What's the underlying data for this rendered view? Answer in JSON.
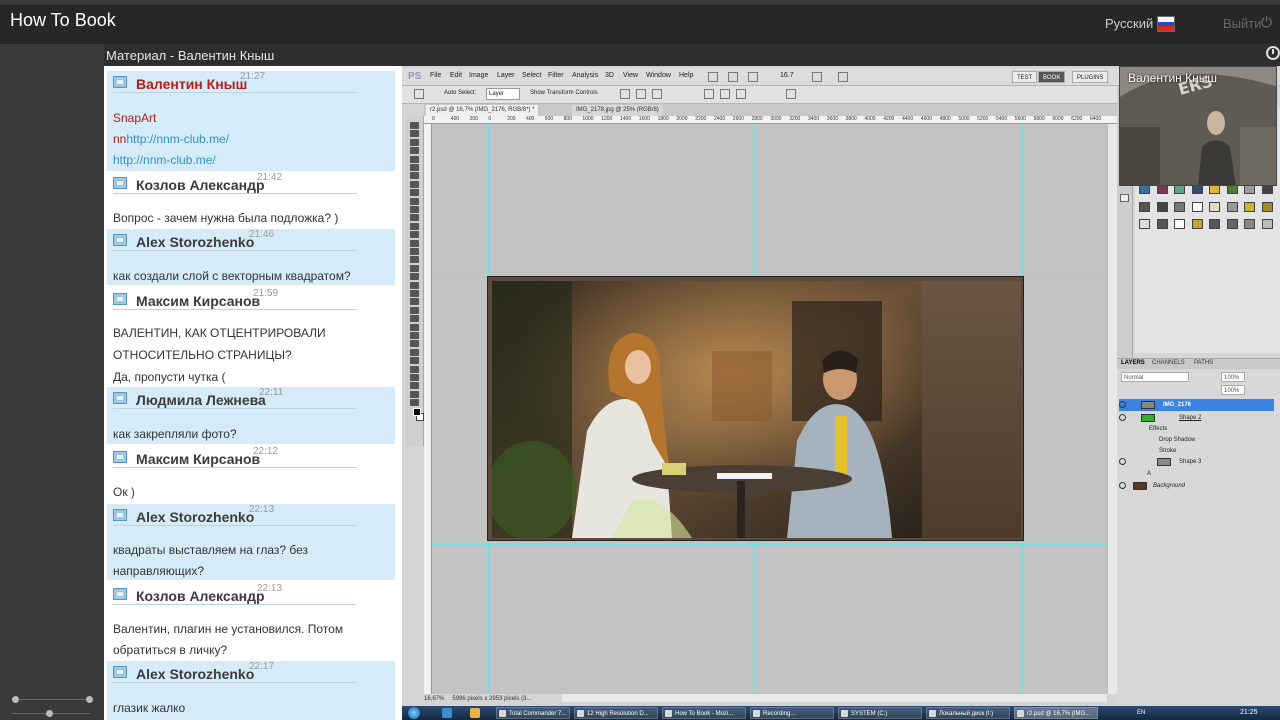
{
  "header": {
    "brand": "How To Book",
    "language": "Русский",
    "logout": "Выйти"
  },
  "material": {
    "title": "Материал - Валентин Кныш"
  },
  "chat": {
    "messages": [
      {
        "name": "Валентин Кныш",
        "time": "21:27",
        "lines": [
          "SnapArt"
        ],
        "link_prefix": "nn",
        "links": [
          "http://nnm-club.me/",
          "http://nnm-club.me/"
        ]
      },
      {
        "name": "Козлов Александр",
        "time": "21:42",
        "lines": [
          "Вопрос - зачем нужна была подложка? )"
        ]
      },
      {
        "name": "Alex Storozhenko",
        "time": "21:46",
        "lines": [
          "как создали слой с векторным квадратом?"
        ]
      },
      {
        "name": "Максим Кирсанов",
        "time": "21:59",
        "lines": [
          "ВАЛЕНТИН, КАК ОТЦЕНТРИРОВАЛИ",
          "ОТНОСИТЕЛЬНО СТРАНИЦЫ?",
          "Да, пропусти чутка ("
        ]
      },
      {
        "name": "Людмила Лежнева",
        "time": "22:11",
        "lines": [
          "как закрепляли фото?"
        ]
      },
      {
        "name": "Максим Кирсанов",
        "time": "22:12",
        "lines": [
          "Ок )"
        ]
      },
      {
        "name": "Alex Storozhenko",
        "time": "22:13",
        "lines": [
          "квадраты выставляем на глаз? без",
          "направляющих?"
        ]
      },
      {
        "name": "Козлов Александр",
        "time": "22:13",
        "lines": [
          "Валентин, плагин не установился. Потом",
          "обратиться в личку?"
        ]
      },
      {
        "name": "Alex Storozhenko",
        "time": "22:17",
        "lines": [
          "глазик жалко"
        ]
      }
    ]
  },
  "photoshop": {
    "logo": "PS",
    "menu": [
      "File",
      "Edit",
      "Image",
      "Layer",
      "Select",
      "Filter",
      "Analysis",
      "3D",
      "View",
      "Window",
      "Help"
    ],
    "zoom_field": "16.7",
    "workspaces": [
      "TEST",
      "BOOK",
      "PLUGINS"
    ],
    "options": {
      "auto_select": "Auto Select:",
      "auto_select_value": "Layer",
      "transform": "Show Transform Controls"
    },
    "tabs": [
      "r2.psd @ 16,7% (IMG_2176, RGB/8*) *",
      "IMG_2178.jpg @ 25% (RGB/8)"
    ],
    "ruler_marks": [
      "0",
      "400",
      "200",
      "0",
      "200",
      "400",
      "600",
      "800",
      "1000",
      "1200",
      "1400",
      "1600",
      "1800",
      "2000",
      "2200",
      "2400",
      "2600",
      "2800",
      "3000",
      "3200",
      "3400",
      "3600",
      "3800",
      "4000",
      "4200",
      "4400",
      "4600",
      "4800",
      "5000",
      "5200",
      "5400",
      "5600",
      "5800",
      "6000",
      "6200",
      "6400"
    ],
    "status": {
      "zoom": "16,67%",
      "size": "5996 pixels x 2953 pixels (3..."
    },
    "layers": {
      "tabs": [
        "LAYERS",
        "CHANNELS",
        "PATHS"
      ],
      "blend": "Normal",
      "opacity": "100%",
      "fill": "100%",
      "rows": [
        "IMG_2176",
        "Shape 2",
        "Effects",
        "Drop Shadow",
        "Stroke",
        "Shape 3",
        "A",
        "Background"
      ]
    }
  },
  "webcam": {
    "label": "Валентин Кныш"
  },
  "taskbar": {
    "tasks": [
      "Total Commander 7...",
      "12 High Resolution D...",
      "How To Book - Mozi...",
      "Recording...",
      "SYSTEM (C:)",
      "Локальный диск (I:)",
      "r2.psd @ 16,7% (IMG..."
    ],
    "tray": "EN",
    "clock": "21:25"
  },
  "colors": {
    "topbar": "#272727",
    "chat_highlight": "#d5ecf8",
    "name_red": "#b0211a",
    "link": "#3390c6",
    "layer_selected": "#3a83e0",
    "guide": "#5fe4e4"
  }
}
